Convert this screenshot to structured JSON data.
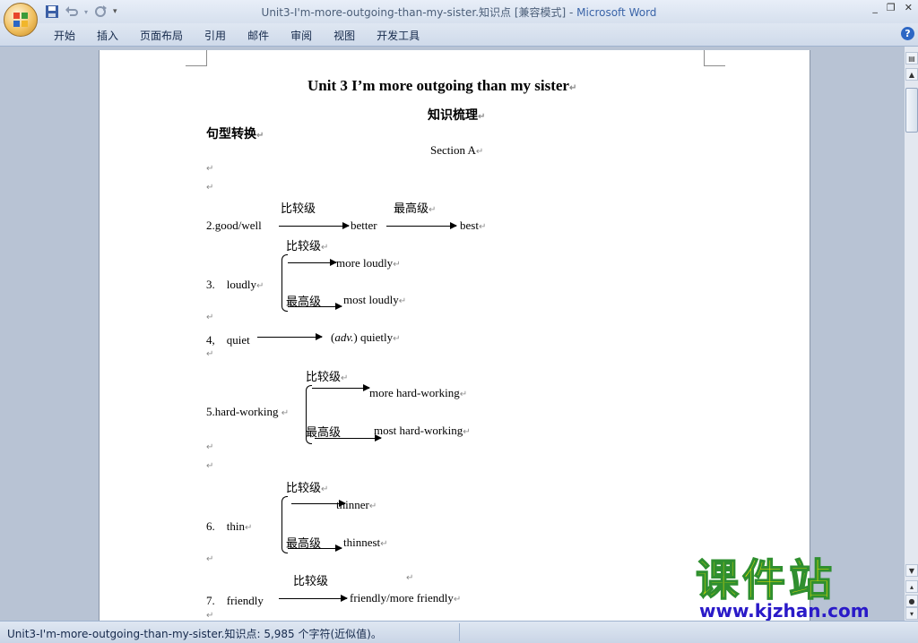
{
  "window": {
    "title": "Unit3-I'm-more-outgoing-than-my-sister.知识点 [兼容模式] - ",
    "app_name": "Microsoft Word"
  },
  "ribbon": {
    "tabs": [
      "开始",
      "插入",
      "页面布局",
      "引用",
      "邮件",
      "审阅",
      "视图",
      "开发工具"
    ]
  },
  "document": {
    "title": "Unit 3 I’m more outgoing than my sister",
    "subtitle": "知识梳理",
    "heading": "句型转换",
    "section": "Section A",
    "item2": {
      "lead": "2.good/well",
      "label_comp": "比较级",
      "label_sup": "最高级",
      "comp": "better",
      "sup": "best"
    },
    "item3": {
      "lead": "3.　loudly",
      "label_comp": "比较级",
      "label_sup": "最高级",
      "comp": "more loudly",
      "sup": "most loudly"
    },
    "item4": {
      "lead": "4,　quiet",
      "paren": "(",
      "adv": "adv.",
      "rest": ") quietly"
    },
    "item5": {
      "lead": "5.hard-working",
      "label_comp": "比较级",
      "label_sup": "最高级",
      "comp": "more hard-working",
      "sup": "most hard-working"
    },
    "item6": {
      "lead": "6.　thin",
      "label_comp": "比较级",
      "label_sup": "最高级",
      "comp": "thinner",
      "sup": "thinnest"
    },
    "item7": {
      "lead": "7.　friendly",
      "label_comp": "比较级",
      "comp": "friendly/more friendly"
    },
    "para_mark": "↵"
  },
  "status": {
    "text": "Unit3-I'm-more-outgoing-than-my-sister.知识点: 5,985 个字符(近似值)。"
  },
  "watermark": {
    "cn": "课件站",
    "url": "www.kjzhan.com"
  },
  "colors": {
    "title_app": "#3a64a8",
    "watermark_fill": "#f1e600",
    "watermark_stroke": "#2f8f2f",
    "watermark_url": "#2a1ac8"
  }
}
